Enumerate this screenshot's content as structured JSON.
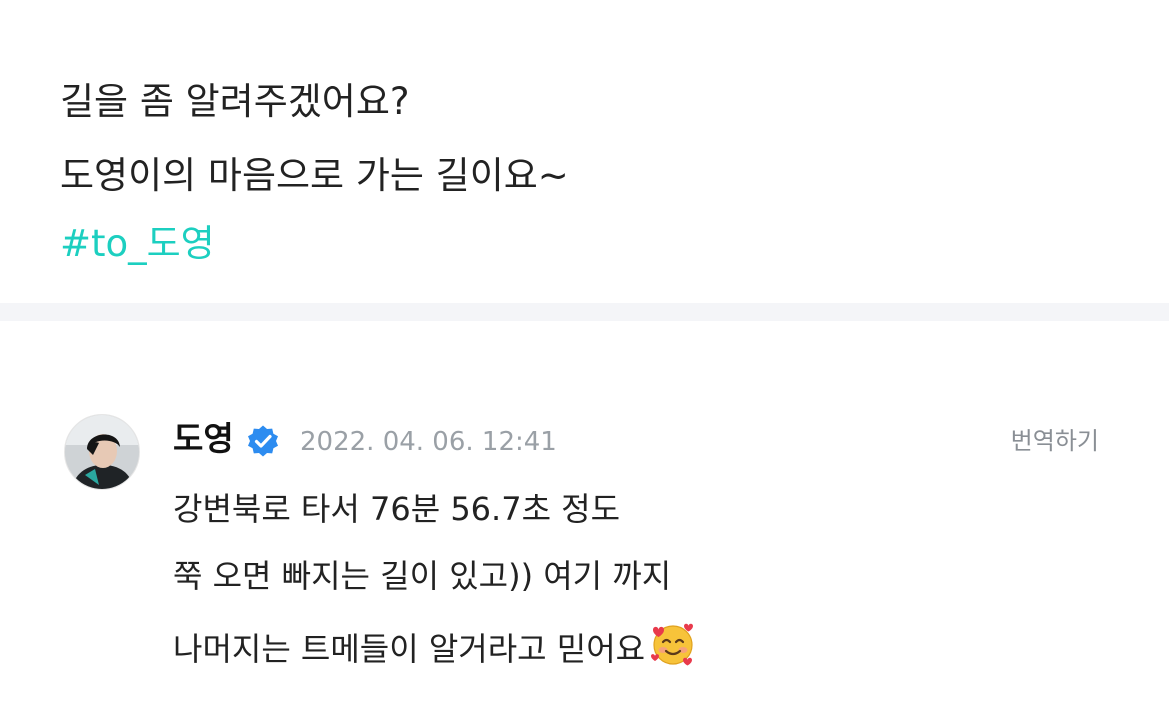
{
  "post": {
    "line1": "길을 좀 알려주겠어요?",
    "line2": "도영이의 마음으로 가는 길이요~",
    "hashtag": "#to_도영",
    "hashtag_color": "#1ccfc0"
  },
  "comment": {
    "author": "도영",
    "verified_icon": "verified-badge-icon",
    "verified_color": "#2d8cf0",
    "timestamp": "2022. 04. 06. 12:41",
    "translate_label": "번역하기",
    "line1": "강변북로 타서 76분 56.7초 정도",
    "line2": "쭉 오면 빠지는 길이 있고)) 여기 까지",
    "line3": "나머지는 트메들이 알거라고 믿어요",
    "emoji": "smiling-face-with-hearts-icon"
  }
}
